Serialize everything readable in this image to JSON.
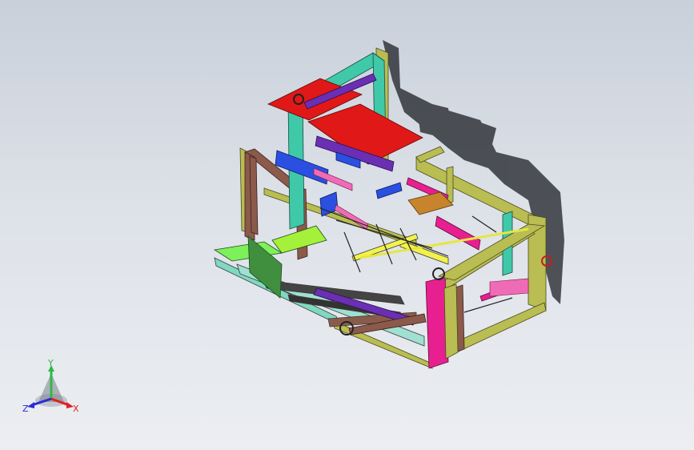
{
  "viewport": {
    "background_top": "#c9d0da",
    "background_bottom": "#eceef2"
  },
  "model": {
    "description_colors": {
      "frame": "#b9bd52",
      "teal": "#3fc9a9",
      "red": "#e01818",
      "purple": "#6a2fb3",
      "magenta": "#e8208f",
      "brown": "#8b5a4a",
      "blue": "#2b4fe0",
      "green": "#5ad65a",
      "pink": "#f06bb5",
      "orange": "#c8842c",
      "shadow": "#1c1f24"
    }
  },
  "triad": {
    "y_label": "Y",
    "x_label": "X",
    "z_label": "Z",
    "y_color": "#2fb84a",
    "x_color": "#e02020",
    "z_color": "#2a2ad8"
  }
}
